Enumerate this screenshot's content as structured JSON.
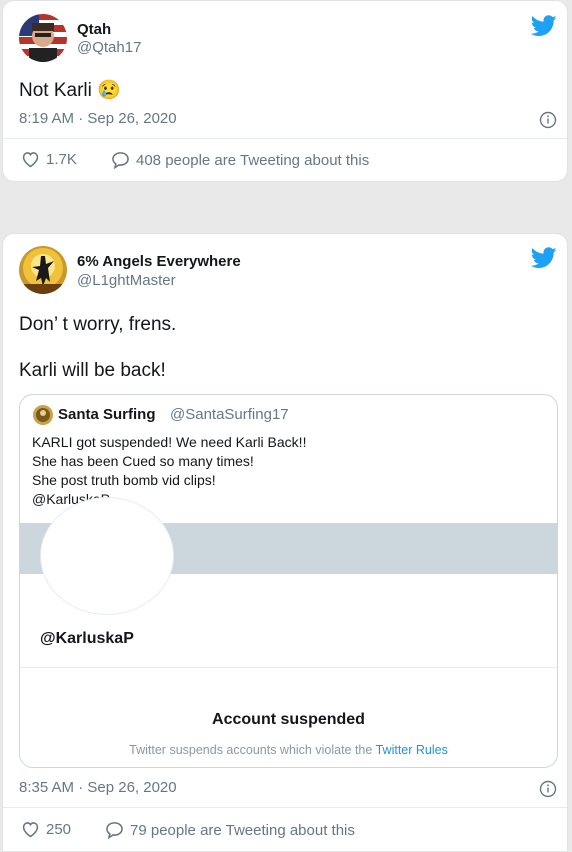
{
  "tweets": [
    {
      "name": "Qtah",
      "handle": "@Qtah17",
      "text_lines": [
        "Not Karli 😢"
      ],
      "timestamp": "8:19 AM · Sep 26, 2020",
      "likes": "1.7K",
      "conversation": "408 people are Tweeting about this"
    },
    {
      "name": "6% Angels Everywhere",
      "handle": "@L1ghtMaster",
      "text_lines": [
        "Don’ t worry, frens.",
        "Karli will be back!"
      ],
      "timestamp": "8:35 AM · Sep 26, 2020",
      "likes": "250",
      "conversation": "79 people are Tweeting about this",
      "quoted": {
        "name": "Santa Surfing",
        "handle": "@SantaSurfing17",
        "lines": [
          "KARLI got suspended!  We need Karli Back!!",
          "She has been Cued so many times!",
          "She post truth bomb vid clips!",
          "@KarluskaP"
        ],
        "profile_handle": "@KarluskaP",
        "suspended_title": "Account suspended",
        "suspended_note": "Twitter suspends accounts which violate the",
        "suspended_link": "Twitter Rules"
      }
    }
  ],
  "icons": {
    "brand": "twitter-bird-icon",
    "info": "info-icon",
    "like": "heart-icon",
    "conversation": "speech-bubble-icon"
  },
  "colors": {
    "twitter_blue": "#1da1f2",
    "secondary_text": "#657786",
    "link": "#1b95e0"
  }
}
